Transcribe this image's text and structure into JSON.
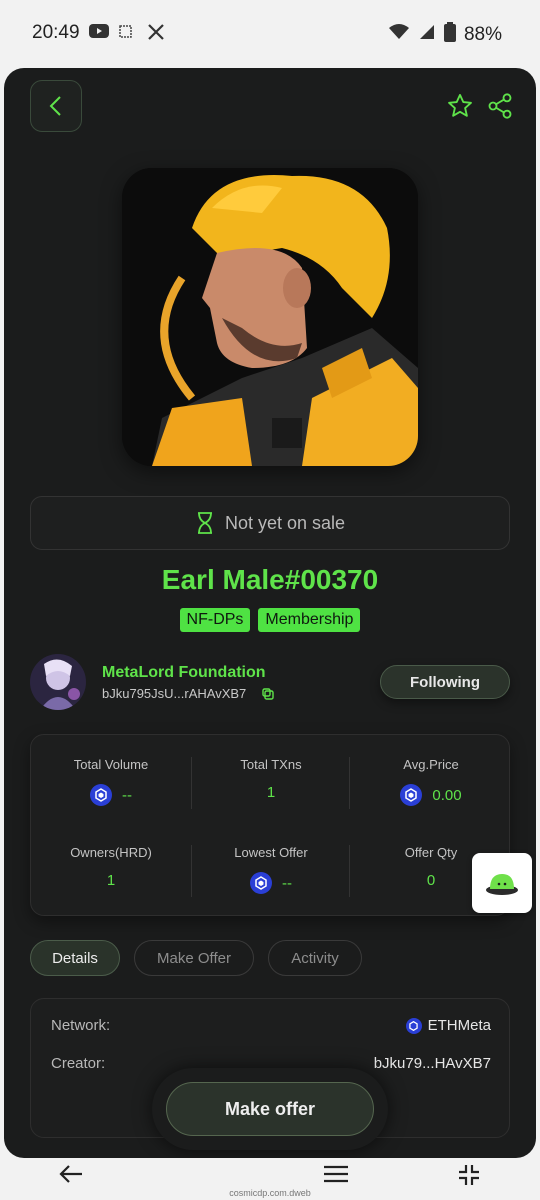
{
  "status_bar": {
    "time": "20:49",
    "battery": "88%"
  },
  "nft": {
    "title": "Earl Male#00370",
    "sale_status": "Not yet on sale",
    "tags": [
      "NF-DPs",
      "Membership"
    ]
  },
  "creator": {
    "name": "MetaLord Foundation",
    "address": "bJku795JsU...rAHAvXB7",
    "follow_label": "Following"
  },
  "stats": [
    {
      "label": "Total Volume",
      "value": "--",
      "coin": true
    },
    {
      "label": "Total TXns",
      "value": "1",
      "coin": false
    },
    {
      "label": "Avg.Price",
      "value": "0.00",
      "coin": true
    },
    {
      "label": "Owners(HRD)",
      "value": "1",
      "coin": false
    },
    {
      "label": "Lowest Offer",
      "value": "--",
      "coin": true
    },
    {
      "label": "Offer Qty",
      "value": "0",
      "coin": false
    }
  ],
  "tabs": [
    {
      "label": "Details",
      "active": true
    },
    {
      "label": "Make Offer",
      "active": false
    },
    {
      "label": "Activity",
      "active": false
    }
  ],
  "details": {
    "network_label": "Network:",
    "network_value": "ETHMeta",
    "creator_label": "Creator:",
    "creator_value": "bJku79...HAvXB7"
  },
  "make_offer_label": "Make offer",
  "url": "cosmicdp.com.dweb",
  "colors": {
    "accent": "#5fe34a",
    "background": "#1b1c1c",
    "coin": "#2a3fd6"
  }
}
